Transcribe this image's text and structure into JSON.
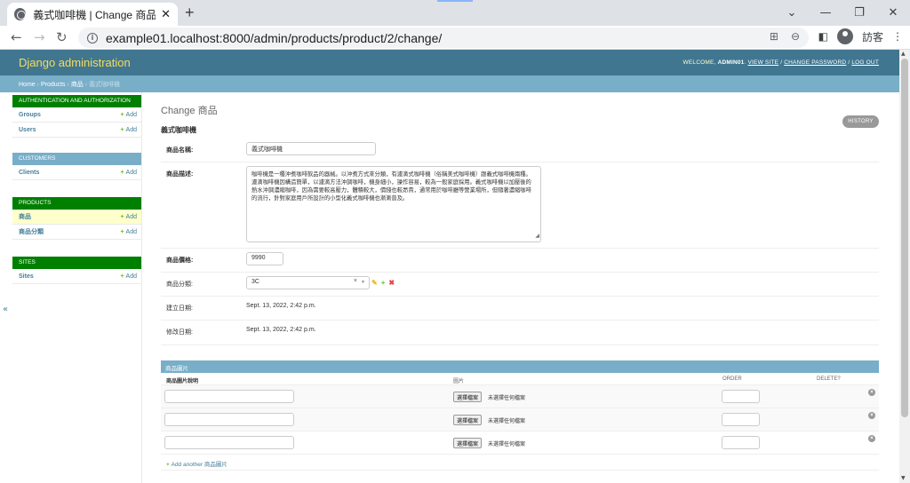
{
  "browser": {
    "tab_title": "義式咖啡機 | Change 商品 | Djan",
    "tab_close": "✕",
    "new_tab": "+",
    "url": "example01.localhost:8000/admin/products/product/2/change/",
    "profile_label": "訪客",
    "nav_back": "←",
    "nav_forward": "→",
    "nav_reload": "↻",
    "menu_icon": "⋮",
    "win_minimize": "—",
    "win_maximize": "❐",
    "win_close": "✕"
  },
  "header": {
    "branding": "Django administration",
    "welcome": "WELCOME,",
    "username": "ADMIN01",
    "view_site": "VIEW SITE",
    "change_password": "CHANGE PASSWORD",
    "log_out": "LOG OUT",
    "sep": "/"
  },
  "breadcrumbs": {
    "home": "Home",
    "app": "Products",
    "model": "商品",
    "current": "義式咖啡機",
    "sep": "›"
  },
  "sidebar": {
    "modules": [
      {
        "caption": "AUTHENTICATION AND AUTHORIZATION",
        "rows": [
          {
            "name": "Groups",
            "add": "Add"
          },
          {
            "name": "Users",
            "add": "Add"
          }
        ]
      },
      {
        "caption": "CUSTOMERS",
        "rows": [
          {
            "name": "Clients",
            "add": "Add"
          }
        ]
      },
      {
        "caption": "PRODUCTS",
        "rows": [
          {
            "name": "商品",
            "add": "Add"
          },
          {
            "name": "商品分類",
            "add": "Add"
          }
        ]
      },
      {
        "caption": "SITES",
        "rows": [
          {
            "name": "Sites",
            "add": "Add"
          }
        ]
      }
    ],
    "collapse": "«"
  },
  "content": {
    "title": "Change 商品",
    "object_title": "義式咖啡機",
    "history": "HISTORY",
    "fields": {
      "name": {
        "label": "商品名稱:",
        "value": "義式咖啡機"
      },
      "description": {
        "label": "商品描述:",
        "value": "咖啡機是一種沖煮咖啡飲品的器械。以沖煮方式來分類，有濾滴式咖啡機（俗稱美式咖啡機）跟義式咖啡機兩種。濾滴咖啡機因構造簡單，以濾滴方法沖調咖啡，機身細小，操作容易，較為一般家庭採用。義式咖啡機以加壓後的熱水沖調濃縮咖啡，因為需要較高壓力，體積較大，價錢也較昂貴，通常用於咖啡廳等營業場所，但隨著濃縮咖啡的流行，針對家庭用戶所設計的小型化義式咖啡機也漸漸普及。"
      },
      "price": {
        "label": "商品價格:",
        "value": "9990"
      },
      "category": {
        "label": "商品分類:",
        "value": "3C",
        "clear": "×",
        "arrow": "▼"
      },
      "created": {
        "label": "建立日期:",
        "value": "Sept. 13, 2022, 2:42 p.m."
      },
      "modified": {
        "label": "修改日期:",
        "value": "Sept. 13, 2022, 2:42 p.m."
      }
    },
    "related_icons": {
      "edit": "✎",
      "add": "+",
      "delete": "✖"
    },
    "inline": {
      "caption": "商品圖片",
      "columns": [
        "商品圖片說明",
        "圖片",
        "ORDER",
        "DELETE?"
      ],
      "rows": [
        {
          "file_button": "選擇檔案",
          "file_status": "未選擇任何檔案",
          "delete": "×"
        },
        {
          "file_button": "選擇檔案",
          "file_status": "未選擇任何檔案",
          "delete": "×"
        },
        {
          "file_button": "選擇檔案",
          "file_status": "未選擇任何檔案",
          "delete": "×"
        }
      ],
      "add_another": "Add another 商品圖片"
    }
  },
  "colors": {
    "header_bg": "#417690",
    "branding": "#f5dd5d",
    "breadcrumbs_bg": "#79aec8",
    "module_green": "#008000",
    "link": "#447e9b"
  }
}
